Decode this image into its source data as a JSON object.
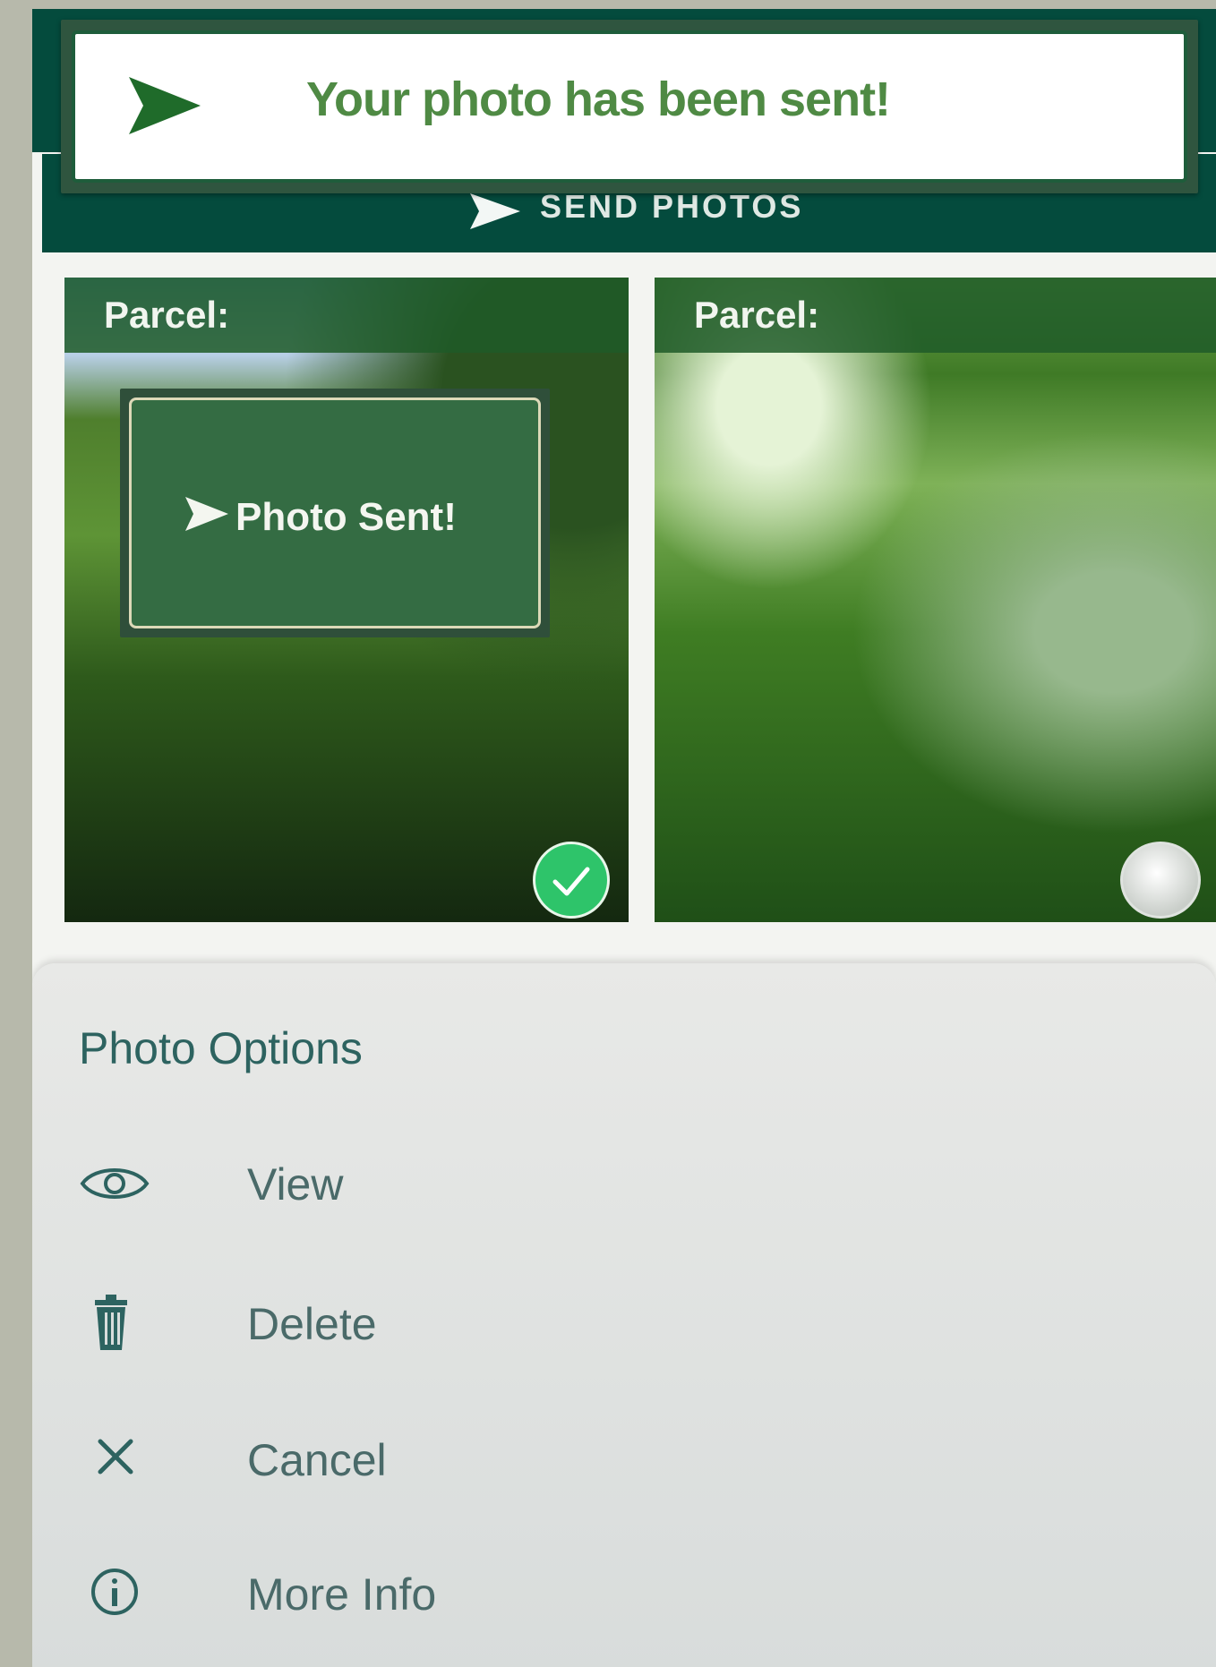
{
  "toast": {
    "message": "Your photo has been sent!",
    "icon": "send-icon"
  },
  "send_button": {
    "label": "SEND PHOTOS",
    "icon": "send-icon"
  },
  "photos": [
    {
      "parcel_label": "Parcel:",
      "status_overlay": "Photo Sent!",
      "selected": true,
      "status_icon": "send-icon"
    },
    {
      "parcel_label": "Parcel:",
      "selected": false
    }
  ],
  "sheet": {
    "title": "Photo Options",
    "options": [
      {
        "label": "View",
        "icon": "eye-icon"
      },
      {
        "label": "Delete",
        "icon": "trash-icon"
      },
      {
        "label": "Cancel",
        "icon": "close-icon"
      },
      {
        "label": "More Info",
        "icon": "info-icon"
      }
    ]
  },
  "colors": {
    "primary": "#044b3d",
    "accent": "#2ec46a",
    "text_secondary": "#4a6a69"
  }
}
